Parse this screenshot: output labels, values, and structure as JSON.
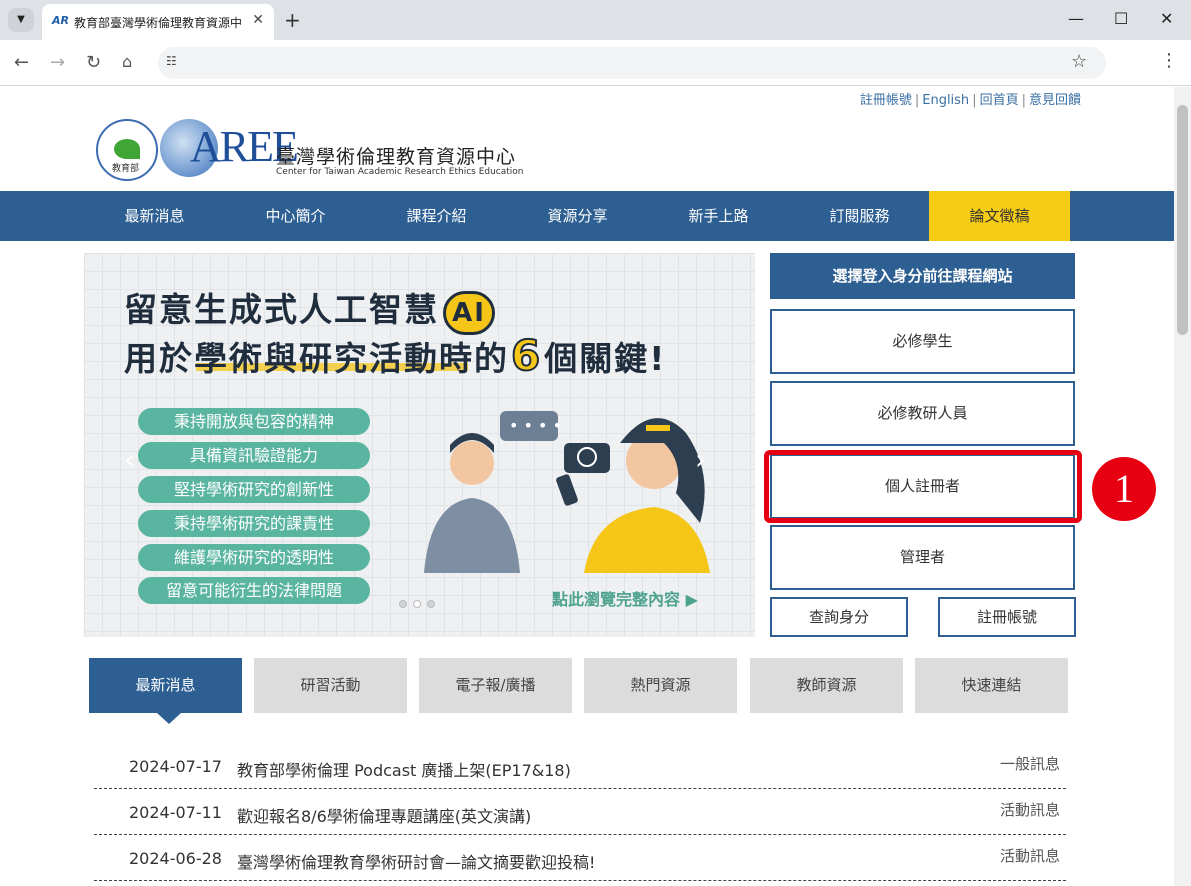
{
  "browser": {
    "tab_title": "教育部臺灣學術倫理教育資源中",
    "new_tab": "+",
    "close_tab": "✕"
  },
  "toplinks": [
    "註冊帳號",
    "English",
    "回首頁",
    "意見回饋"
  ],
  "header": {
    "moe_label": "教育部",
    "logo_text": "AREE",
    "title": "臺灣學術倫理教育資源中心",
    "subtitle": "Center for Taiwan Academic Research Ethics Education"
  },
  "nav": [
    "最新消息",
    "中心簡介",
    "課程介紹",
    "資源分享",
    "新手上路",
    "訂閱服務",
    "論文徵稿"
  ],
  "banner": {
    "line1": "留意生成式人工智慧",
    "ai": "AI",
    "line2a": "用於學術與研究活動時的",
    "six": "6",
    "line2b": "個關鍵!",
    "pills": [
      "秉持開放與包容的精神",
      "具備資訊驗證能力",
      "堅持學術研究的創新性",
      "秉持學術研究的課責性",
      "維護學術研究的透明性",
      "留意可能衍生的法律問題"
    ],
    "more": "點此瀏覽完整內容 ▶"
  },
  "login": {
    "title": "選擇登入身分前往課程網站",
    "roles": [
      "必修學生",
      "必修教研人員",
      "個人註冊者",
      "管理者"
    ],
    "query": "查詢身分",
    "register": "註冊帳號",
    "badge": "1"
  },
  "tabs": [
    "最新消息",
    "研習活動",
    "電子報/廣播",
    "熱門資源",
    "教師資源",
    "快速連結"
  ],
  "news": [
    {
      "date": "2024-07-17",
      "title": "教育部學術倫理 Podcast 廣播上架(EP17&18)",
      "tag": "一般訊息"
    },
    {
      "date": "2024-07-11",
      "title": "歡迎報名8/6學術倫理專題講座(英文演講)",
      "tag": "活動訊息"
    },
    {
      "date": "2024-06-28",
      "title": "臺灣學術倫理教育學術研討會—論文摘要歡迎投稿!",
      "tag": "活動訊息"
    }
  ]
}
